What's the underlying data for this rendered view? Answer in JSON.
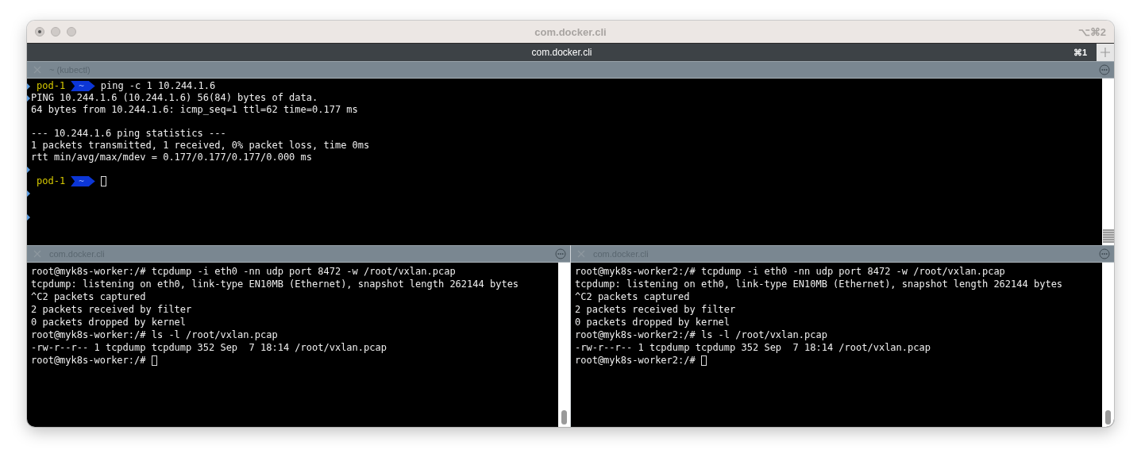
{
  "window": {
    "title": "com.docker.cli",
    "shortcut": "⌥⌘2"
  },
  "tabs": [
    {
      "label": "com.docker.cli",
      "shortcut": "⌘1",
      "selected": true
    }
  ],
  "top_pane": {
    "title": "~ (kubectl)",
    "lines": [
      {
        "kind": "prompt",
        "marker": true,
        "host": "pod-1",
        "dir": "~",
        "command": "ping -c 1 10.244.1.6",
        "cursor": false
      },
      {
        "kind": "output",
        "marker": true,
        "text": "PING 10.244.1.6 (10.244.1.6) 56(84) bytes of data."
      },
      {
        "kind": "output",
        "marker": false,
        "text": "64 bytes from 10.244.1.6: icmp_seq=1 ttl=62 time=0.177 ms"
      },
      {
        "kind": "blank",
        "marker": false
      },
      {
        "kind": "output",
        "marker": false,
        "text": "--- 10.244.1.6 ping statistics ---"
      },
      {
        "kind": "output",
        "marker": false,
        "text": "1 packets transmitted, 1 received, 0% packet loss, time 0ms"
      },
      {
        "kind": "output",
        "marker": false,
        "text": "rtt min/avg/max/mdev = 0.177/0.177/0.177/0.000 ms"
      },
      {
        "kind": "blank",
        "marker": true
      },
      {
        "kind": "prompt",
        "marker": false,
        "host": "pod-1",
        "dir": "~",
        "cursor": true
      },
      {
        "kind": "blank",
        "marker": true
      },
      {
        "kind": "blank",
        "marker": false
      },
      {
        "kind": "blank",
        "marker": true
      }
    ]
  },
  "bottom_panes": [
    {
      "title": "com.docker.cli",
      "lines": [
        {
          "text": "root@myk8s-worker:/# tcpdump -i eth0 -nn udp port 8472 -w /root/vxlan.pcap",
          "cursor": false
        },
        {
          "text": "tcpdump: listening on eth0, link-type EN10MB (Ethernet), snapshot length 262144 bytes",
          "cursor": false
        },
        {
          "text": "^C2 packets captured",
          "cursor": false
        },
        {
          "text": "2 packets received by filter",
          "cursor": false
        },
        {
          "text": "0 packets dropped by kernel",
          "cursor": false
        },
        {
          "text": "root@myk8s-worker:/# ls -l /root/vxlan.pcap",
          "cursor": false
        },
        {
          "text": "-rw-r--r-- 1 tcpdump tcpdump 352 Sep  7 18:14 /root/vxlan.pcap",
          "cursor": false
        },
        {
          "text": "root@myk8s-worker:/#",
          "cursor": true
        }
      ]
    },
    {
      "title": "com.docker.cli",
      "lines": [
        {
          "text": "root@myk8s-worker2:/# tcpdump -i eth0 -nn udp port 8472 -w /root/vxlan.pcap",
          "cursor": false
        },
        {
          "text": "tcpdump: listening on eth0, link-type EN10MB (Ethernet), snapshot length 262144 bytes",
          "cursor": false
        },
        {
          "text": "^C2 packets captured",
          "cursor": false
        },
        {
          "text": "2 packets received by filter",
          "cursor": false
        },
        {
          "text": "0 packets dropped by kernel",
          "cursor": false
        },
        {
          "text": "root@myk8s-worker2:/# ls -l /root/vxlan.pcap",
          "cursor": false
        },
        {
          "text": "-rw-r--r-- 1 tcpdump tcpdump 352 Sep  7 18:14 /root/vxlan.pcap",
          "cursor": false
        },
        {
          "text": "root@myk8s-worker2:/#",
          "cursor": true
        }
      ]
    }
  ]
}
